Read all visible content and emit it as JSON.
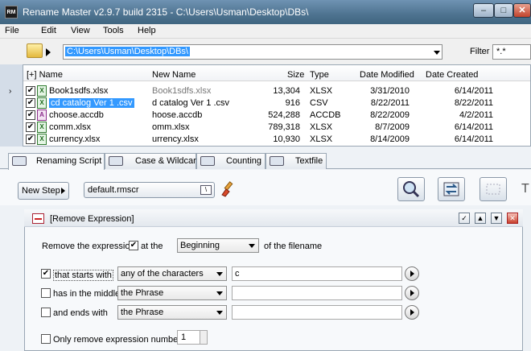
{
  "window": {
    "app_icon": "RM",
    "title": "Rename Master v2.9.7 build 2315 - C:\\Users\\Usman\\Desktop\\DBs\\"
  },
  "menu": [
    "File",
    "Edit",
    "View",
    "Tools",
    "Help"
  ],
  "address": {
    "path": "C:\\Users\\Usman\\Desktop\\DBs\\",
    "filter_label": "Filter",
    "filter_value": "*.*"
  },
  "filelist": {
    "headers": [
      "[+] Name",
      "New Name",
      "Size",
      "Type",
      "Date Modified",
      "Date Created"
    ],
    "rows": [
      {
        "name": "Book1sdfs.xlsx",
        "new_name": "Book1sdfs.xlsx",
        "size": "13,304",
        "type": "XLSX",
        "modified": "3/31/2010",
        "created": "6/14/2011",
        "icon": "X"
      },
      {
        "name": "cd catalog Ver 1 .csv",
        "new_name": "d catalog Ver 1 .csv",
        "size": "916",
        "type": "CSV",
        "modified": "8/22/2011",
        "created": "8/22/2011",
        "icon": "X"
      },
      {
        "name": "choose.accdb",
        "new_name": "hoose.accdb",
        "size": "524,288",
        "type": "ACCDB",
        "modified": "8/22/2009",
        "created": "4/2/2011",
        "icon": "A"
      },
      {
        "name": "comm.xlsx",
        "new_name": "omm.xlsx",
        "size": "789,318",
        "type": "XLSX",
        "modified": "8/7/2009",
        "created": "6/14/2011",
        "icon": "X"
      },
      {
        "name": "currency.xlsx",
        "new_name": "urrency.xlsx",
        "size": "10,930",
        "type": "XLSX",
        "modified": "8/14/2009",
        "created": "6/14/2011",
        "icon": "X"
      }
    ]
  },
  "tabs": [
    "Renaming Script",
    "Case & Wildcards",
    "Counting",
    "Textfile"
  ],
  "toolbar": {
    "new_step": "New Step",
    "script_file": "default.rmscr"
  },
  "step": {
    "title": "[Remove Expression]",
    "remove_label": "Remove the expression",
    "at_the": "at the",
    "position": "Beginning",
    "of_filename": "of the filename",
    "starts_label": "that starts with",
    "starts_mode": "any of the characters",
    "starts_value": "c",
    "middle_label": "has in the middle",
    "middle_mode": "the Phrase",
    "ends_label": "and ends with",
    "ends_mode": "the Phrase",
    "only_label": "Only remove expression number",
    "only_value": "1"
  }
}
